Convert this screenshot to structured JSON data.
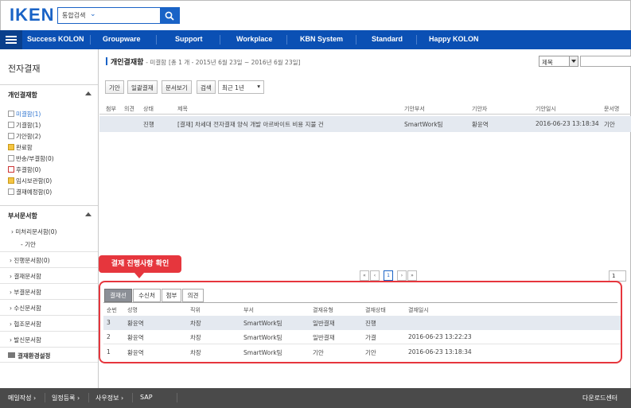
{
  "logo": "IKEN",
  "search": {
    "scope": "통합검색"
  },
  "nav": [
    "Success KOLON",
    "Groupware",
    "Support",
    "Workplace",
    "KBN System",
    "Standard",
    "Happy KOLON"
  ],
  "sidebar": {
    "title": "전자결재",
    "personal": {
      "heading": "개인결재함",
      "items": [
        "미결함(1)",
        "기결함(1)",
        "기안함(2)",
        "완료함",
        "반송/부결함(0)",
        "후결함(0)",
        "임시보관함(0)",
        "결재예정함(0)"
      ]
    },
    "dept": {
      "heading": "부서문서함",
      "items": [
        "미처리문서함(0)",
        "- 기안",
        "진행문서함(0)",
        "결재문서함",
        "부결문서함",
        "수신문서함",
        "협조문서함",
        "발신문서함"
      ]
    },
    "settings": "결재환경설정"
  },
  "main": {
    "title": "개인결재함",
    "subtitle": "- 미결함",
    "range": "[총 1 개 - 2015년 6월 23일 ~ 2016년 6월 23일]",
    "filter_select": "제목",
    "toolbar": [
      "기안",
      "일괄결재",
      "문서보기",
      "검색"
    ],
    "period": "최근 1년",
    "columns": [
      "첨부",
      "의견",
      "상태",
      "제목",
      "기안부서",
      "기안자",
      "기안일시",
      "문서명"
    ],
    "rows": [
      {
        "status": "진행",
        "title": "[결재] 차세대 전자결재 양식 개발 아르바이트 비용 지불 건",
        "dept": "SmartWork팀",
        "drafter": "황윤역",
        "date": "2016-06-23 13:18:34",
        "doc": "기안"
      }
    ],
    "pager": {
      "first": "«",
      "prev": "‹",
      "current": "1",
      "next": "›",
      "last": "»",
      "page_input": "1"
    }
  },
  "callout": "결재 진행사항 확인",
  "approval": {
    "tabs": [
      "결재선",
      "수신처",
      "첨부",
      "의견"
    ],
    "columns": [
      "순번",
      "성명",
      "직위",
      "부서",
      "결재유형",
      "결재상태",
      "결재일시"
    ],
    "rows": [
      {
        "no": "3",
        "name": "황윤역",
        "position": "차장",
        "dept": "SmartWork팀",
        "type": "일반결재",
        "state": "진행",
        "date": ""
      },
      {
        "no": "2",
        "name": "황윤역",
        "position": "차장",
        "dept": "SmartWork팀",
        "type": "일반결재",
        "state": "가결",
        "date": "2016-06-23 13:22:23"
      },
      {
        "no": "1",
        "name": "황윤역",
        "position": "차장",
        "dept": "SmartWork팀",
        "type": "기안",
        "state": "기안",
        "date": "2016-06-23 13:18:34"
      }
    ]
  },
  "footer": {
    "items": [
      "메일작성",
      "일정등록",
      "사우정보",
      "SAP"
    ],
    "download": "다운로드센터"
  }
}
